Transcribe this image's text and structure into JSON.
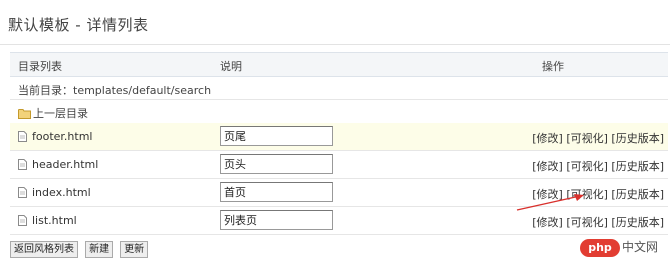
{
  "page": {
    "title": "默认模板 - 详情列表"
  },
  "table": {
    "headers": {
      "dir": "目录列表",
      "desc": "说明",
      "ops": "操作"
    },
    "current_dir": "当前目录：templates/default/search",
    "up_dir": "上一层目录",
    "rows": [
      {
        "name": "footer.html",
        "desc": "页尾"
      },
      {
        "name": "header.html",
        "desc": "页头"
      },
      {
        "name": "index.html",
        "desc": "首页"
      },
      {
        "name": "list.html",
        "desc": "列表页"
      }
    ],
    "ops": {
      "edit": "[修改]",
      "visual": "[可视化]",
      "history": "[历史版本]"
    }
  },
  "buttons": {
    "back": "返回风格列表",
    "new": "新建",
    "update": "更新"
  },
  "watermark": {
    "logo": "php",
    "text": "中文网"
  },
  "icons": {
    "folder": "folder-icon",
    "file": "file-icon",
    "annotation": "red-arrow"
  },
  "colors": {
    "highlight_row": "#fdfde8",
    "header_bg": "#f4f6f8",
    "arrow": "#d9302c"
  }
}
